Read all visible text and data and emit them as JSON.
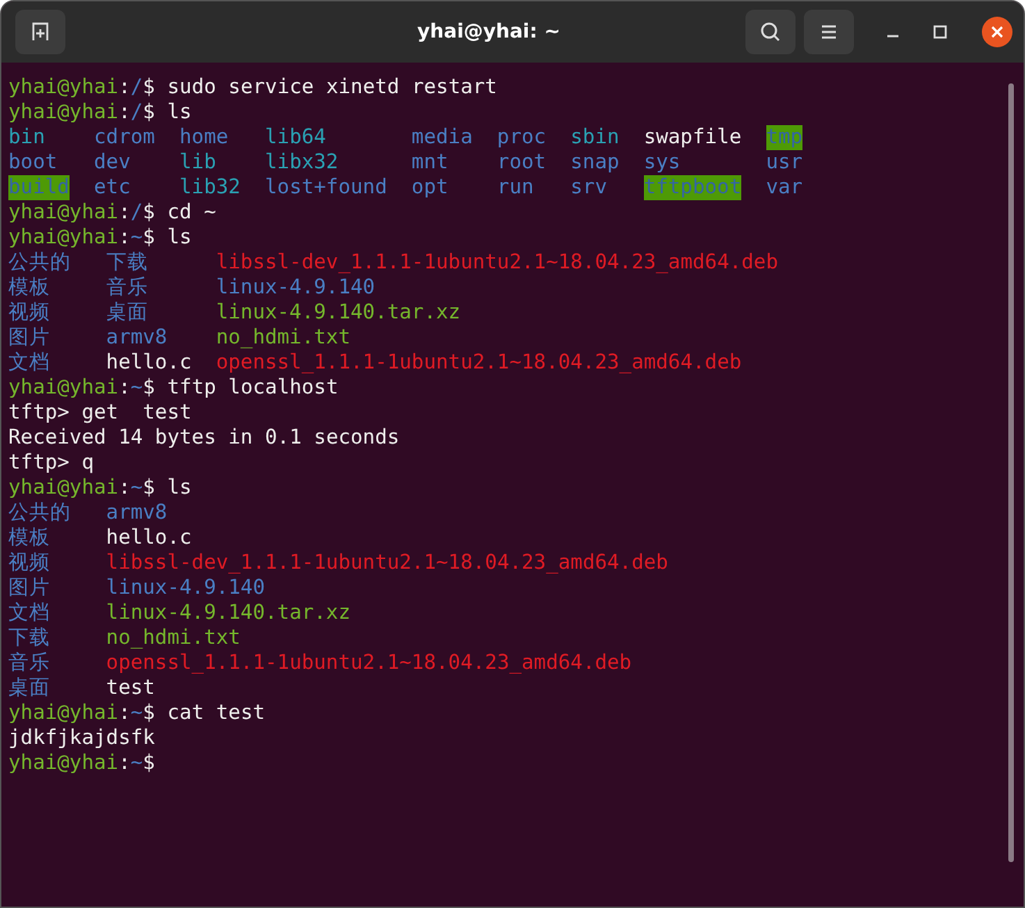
{
  "window": {
    "title": "yhai@yhai: ~"
  },
  "lines": [
    {
      "kind": "prompt",
      "user": "yhai@yhai",
      "colon": ":",
      "path": "/",
      "command": "$ sudo service xinetd restart"
    },
    {
      "kind": "prompt",
      "user": "yhai@yhai",
      "colon": ":",
      "path": "/",
      "command": "$ ls"
    },
    {
      "kind": "ls",
      "rows": [
        [
          {
            "name": "bin",
            "kind": "link"
          },
          {
            "name": "cdrom",
            "kind": "dir"
          },
          {
            "name": "home",
            "kind": "dir"
          },
          {
            "name": "lib64",
            "kind": "link"
          },
          {
            "name": "media",
            "kind": "dir"
          },
          {
            "name": "proc",
            "kind": "dir"
          },
          {
            "name": "sbin",
            "kind": "link"
          },
          {
            "name": "swapfile",
            "kind": "file"
          },
          {
            "name": "tmp",
            "kind": "sticky"
          }
        ],
        [
          {
            "name": "boot",
            "kind": "dir"
          },
          {
            "name": "dev",
            "kind": "dir"
          },
          {
            "name": "lib",
            "kind": "link"
          },
          {
            "name": "libx32",
            "kind": "link"
          },
          {
            "name": "mnt",
            "kind": "dir"
          },
          {
            "name": "root",
            "kind": "dir"
          },
          {
            "name": "snap",
            "kind": "dir"
          },
          {
            "name": "sys",
            "kind": "dir"
          },
          {
            "name": "usr",
            "kind": "dir"
          }
        ],
        [
          {
            "name": "build",
            "kind": "sticky"
          },
          {
            "name": "etc",
            "kind": "dir"
          },
          {
            "name": "lib32",
            "kind": "link"
          },
          {
            "name": "lost+found",
            "kind": "dir"
          },
          {
            "name": "opt",
            "kind": "dir"
          },
          {
            "name": "run",
            "kind": "dir"
          },
          {
            "name": "srv",
            "kind": "dir"
          },
          {
            "name": "tftpboot",
            "kind": "sticky"
          },
          {
            "name": "var",
            "kind": "dir"
          }
        ]
      ]
    },
    {
      "kind": "prompt",
      "user": "yhai@yhai",
      "colon": ":",
      "path": "/",
      "command": "$ cd ~"
    },
    {
      "kind": "prompt",
      "user": "yhai@yhai",
      "colon": ":",
      "path": "~",
      "command": "$ ls"
    },
    {
      "kind": "ls",
      "rows": [
        [
          {
            "name": "公共的",
            "kind": "dir"
          },
          {
            "name": "下载",
            "kind": "dir"
          },
          {
            "name": "libssl-dev_1.1.1-1ubuntu2.1~18.04.23_amd64.deb",
            "kind": "archive"
          }
        ],
        [
          {
            "name": "模板",
            "kind": "dir"
          },
          {
            "name": "音乐",
            "kind": "dir"
          },
          {
            "name": "linux-4.9.140",
            "kind": "dir"
          }
        ],
        [
          {
            "name": "视频",
            "kind": "dir"
          },
          {
            "name": "桌面",
            "kind": "dir"
          },
          {
            "name": "linux-4.9.140.tar.xz",
            "kind": "exec"
          }
        ],
        [
          {
            "name": "图片",
            "kind": "dir"
          },
          {
            "name": "armv8",
            "kind": "dir"
          },
          {
            "name": "no_hdmi.txt",
            "kind": "exec"
          }
        ],
        [
          {
            "name": "文档",
            "kind": "dir"
          },
          {
            "name": "hello.c",
            "kind": "file"
          },
          {
            "name": "openssl_1.1.1-1ubuntu2.1~18.04.23_amd64.deb",
            "kind": "archive"
          }
        ]
      ]
    },
    {
      "kind": "prompt",
      "user": "yhai@yhai",
      "colon": ":",
      "path": "~",
      "command": "$ tftp localhost"
    },
    {
      "kind": "output",
      "text": "tftp> get  test"
    },
    {
      "kind": "output",
      "text": "Received 14 bytes in 0.1 seconds"
    },
    {
      "kind": "output",
      "text": "tftp> q"
    },
    {
      "kind": "prompt",
      "user": "yhai@yhai",
      "colon": ":",
      "path": "~",
      "command": "$ ls"
    },
    {
      "kind": "ls",
      "rows": [
        [
          {
            "name": "公共的",
            "kind": "dir"
          },
          {
            "name": "armv8",
            "kind": "dir"
          }
        ],
        [
          {
            "name": "模板",
            "kind": "dir"
          },
          {
            "name": "hello.c",
            "kind": "file"
          }
        ],
        [
          {
            "name": "视频",
            "kind": "dir"
          },
          {
            "name": "libssl-dev_1.1.1-1ubuntu2.1~18.04.23_amd64.deb",
            "kind": "archive"
          }
        ],
        [
          {
            "name": "图片",
            "kind": "dir"
          },
          {
            "name": "linux-4.9.140",
            "kind": "dir"
          }
        ],
        [
          {
            "name": "文档",
            "kind": "dir"
          },
          {
            "name": "linux-4.9.140.tar.xz",
            "kind": "exec"
          }
        ],
        [
          {
            "name": "下载",
            "kind": "dir"
          },
          {
            "name": "no_hdmi.txt",
            "kind": "exec"
          }
        ],
        [
          {
            "name": "音乐",
            "kind": "dir"
          },
          {
            "name": "openssl_1.1.1-1ubuntu2.1~18.04.23_amd64.deb",
            "kind": "archive"
          }
        ],
        [
          {
            "name": "桌面",
            "kind": "dir"
          },
          {
            "name": "test",
            "kind": "file"
          }
        ]
      ]
    },
    {
      "kind": "prompt",
      "user": "yhai@yhai",
      "colon": ":",
      "path": "~",
      "command": "$ cat test"
    },
    {
      "kind": "output",
      "text": "jdkfjkajdsfk"
    },
    {
      "kind": "prompt",
      "user": "yhai@yhai",
      "colon": ":",
      "path": "~",
      "command": "$"
    }
  ]
}
